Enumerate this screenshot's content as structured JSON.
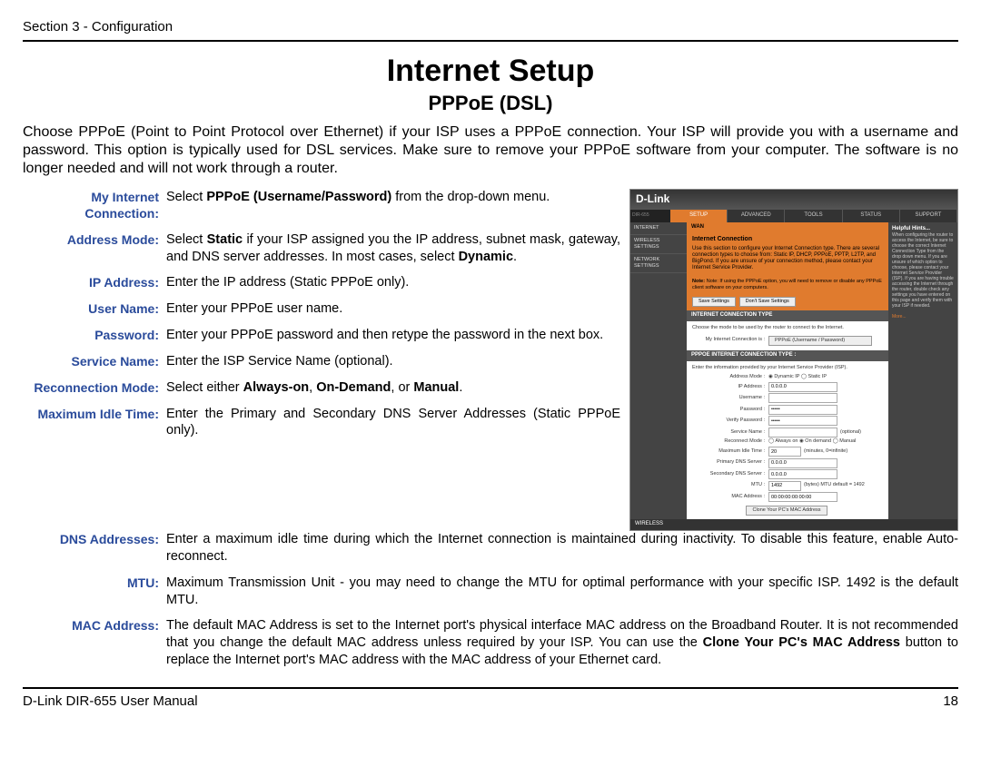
{
  "header": "Section 3 - Configuration",
  "title": "Internet Setup",
  "subtitle": "PPPoE (DSL)",
  "intro": "Choose PPPoE (Point to Point Protocol over Ethernet) if your ISP uses a PPPoE connection. Your ISP will provide you with a username and password. This option is typically used for DSL services. Make sure to remove your PPPoE software from your computer. The software is no longer needed and will not work through a router.",
  "defs": [
    {
      "label": "My Internet Connection:",
      "html": "Select <b>PPPoE (Username/Password)</b> from the drop-down menu."
    },
    {
      "label": "Address Mode:",
      "html": "Select <b>Static</b> if your ISP assigned you the IP address, subnet mask, gateway, and DNS server addresses. In most cases, select <b>Dynamic</b>."
    },
    {
      "label": "IP Address:",
      "html": "Enter the IP address (Static PPPoE only)."
    },
    {
      "label": "User Name:",
      "html": "Enter your PPPoE user name."
    },
    {
      "label": "Password:",
      "html": "Enter your PPPoE password and then retype the password in the next box."
    },
    {
      "label": "Service Name:",
      "html": "Enter the ISP Service Name (optional)."
    },
    {
      "label": "Reconnection Mode:",
      "html": "Select either <b>Always-on</b>, <b>On-Demand</b>, or <b>Manual</b>."
    },
    {
      "label": "Maximum Idle Time:",
      "html": "Enter the Primary and Secondary DNS Server Addresses (Static PPPoE only)."
    }
  ],
  "defs_full": [
    {
      "label": "DNS Addresses:",
      "html": "Enter a maximum idle time during which the Internet connection is maintained during inactivity. To disable this feature, enable Auto-reconnect."
    },
    {
      "label": "MTU:",
      "html": "Maximum Transmission Unit - you may need to change the MTU for optimal performance with your specific ISP. 1492 is the default MTU."
    },
    {
      "label": "MAC Address:",
      "html": "The default MAC Address is set to the Internet port's physical interface MAC address on the Broadband Router. It is not recommended that you change the default MAC address unless required by your ISP.  You can use the <b>Clone Your PC's MAC Address</b> button to replace the Internet port's MAC address with the MAC address of your Ethernet card."
    }
  ],
  "footer_left": "D-Link DIR-655 User Manual",
  "footer_right": "18",
  "screenshot": {
    "brand": "D-Link",
    "tabs": [
      "SETUP",
      "ADVANCED",
      "TOOLS",
      "STATUS",
      "SUPPORT"
    ],
    "side": [
      "INTERNET",
      "WIRELESS SETTINGS",
      "NETWORK SETTINGS"
    ],
    "wan_title": "WAN",
    "ic_title": "Internet Connection",
    "ic_text": "Use this section to configure your Internet Connection type. There are several connection types to choose from: Static IP, DHCP, PPPoE, PPTP, L2TP, and BigPond. If you are unsure of your connection method, please contact your Internet Service Provider.",
    "ic_note": "Note: If using the PPPoE option, you will need to remove or disable any PPPoE client software on your computers.",
    "btn_save": "Save Settings",
    "btn_dont": "Don't Save Settings",
    "ict_title": "INTERNET CONNECTION TYPE",
    "ict_text": "Choose the mode to be used by the router to connect to the Internet.",
    "ict_label": "My Internet Connection is :",
    "ict_value": "PPPoE (Username / Password)",
    "pict_title": "PPPOE INTERNET CONNECTION TYPE :",
    "pict_text": "Enter the information provided by your Internet Service Provider (ISP).",
    "fields": {
      "address_mode": "Address Mode :",
      "address_mode_v": "◉ Dynamic IP  ◯ Static IP",
      "ip": "IP Address :",
      "ip_v": "0.0.0.0",
      "user": "Username :",
      "user_v": "",
      "pass": "Password :",
      "pass_v": "•••••",
      "vpass": "Verify Password :",
      "vpass_v": "•••••",
      "sname": "Service Name :",
      "sname_v": "",
      "sname_opt": "(optional)",
      "rmode": "Reconnect Mode :",
      "rmode_v": "◯ Always on  ◉ On demand  ◯ Manual",
      "idle": "Maximum Idle Time :",
      "idle_v": "20",
      "idle_h": "(minutes, 0=infinite)",
      "pdns": "Primary DNS Server :",
      "pdns_v": "0.0.0.0",
      "sdns": "Secondary DNS Server :",
      "sdns_v": "0.0.0.0",
      "mtu": "MTU :",
      "mtu_v": "1492",
      "mtu_h": "(bytes) MTU default = 1492",
      "mac": "MAC Address :",
      "mac_v": "00:00:00:00:00:00",
      "clone": "Clone Your PC's MAC Address"
    },
    "help_title": "Helpful Hints...",
    "help_text": "When configuring the router to access the Internet, be sure to choose the correct Internet Connection Type from the drop down menu. If you are unsure of which option to choose, please contact your Internet Service Provider (ISP). If you are having trouble accessing the Internet through the router, double check any settings you have entered on this page and verify them with your ISP if needed.",
    "help_more": "More...",
    "wireless": "WIRELESS"
  }
}
